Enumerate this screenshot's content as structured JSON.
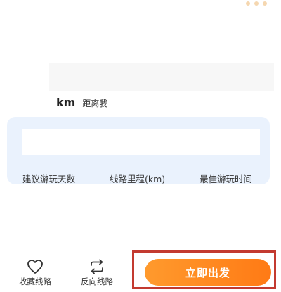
{
  "distance": {
    "unit": "km",
    "label": "距离我"
  },
  "route_info": {
    "labels": [
      "建议游玩天数",
      "线路里程(km)",
      "最佳游玩时间"
    ]
  },
  "bottom_bar": {
    "favorite_label": "收藏线路",
    "reverse_label": "反向线路",
    "go_label": "立即出发"
  },
  "icons": {
    "favorite": "heart-outline-icon",
    "reverse": "swap-arrows-icon"
  },
  "colors": {
    "go_button_start": "#ff9a2d",
    "go_button_end": "#ff7a15",
    "highlight_border": "#c33a30",
    "info_panel_bg": "#eaf2fd"
  }
}
